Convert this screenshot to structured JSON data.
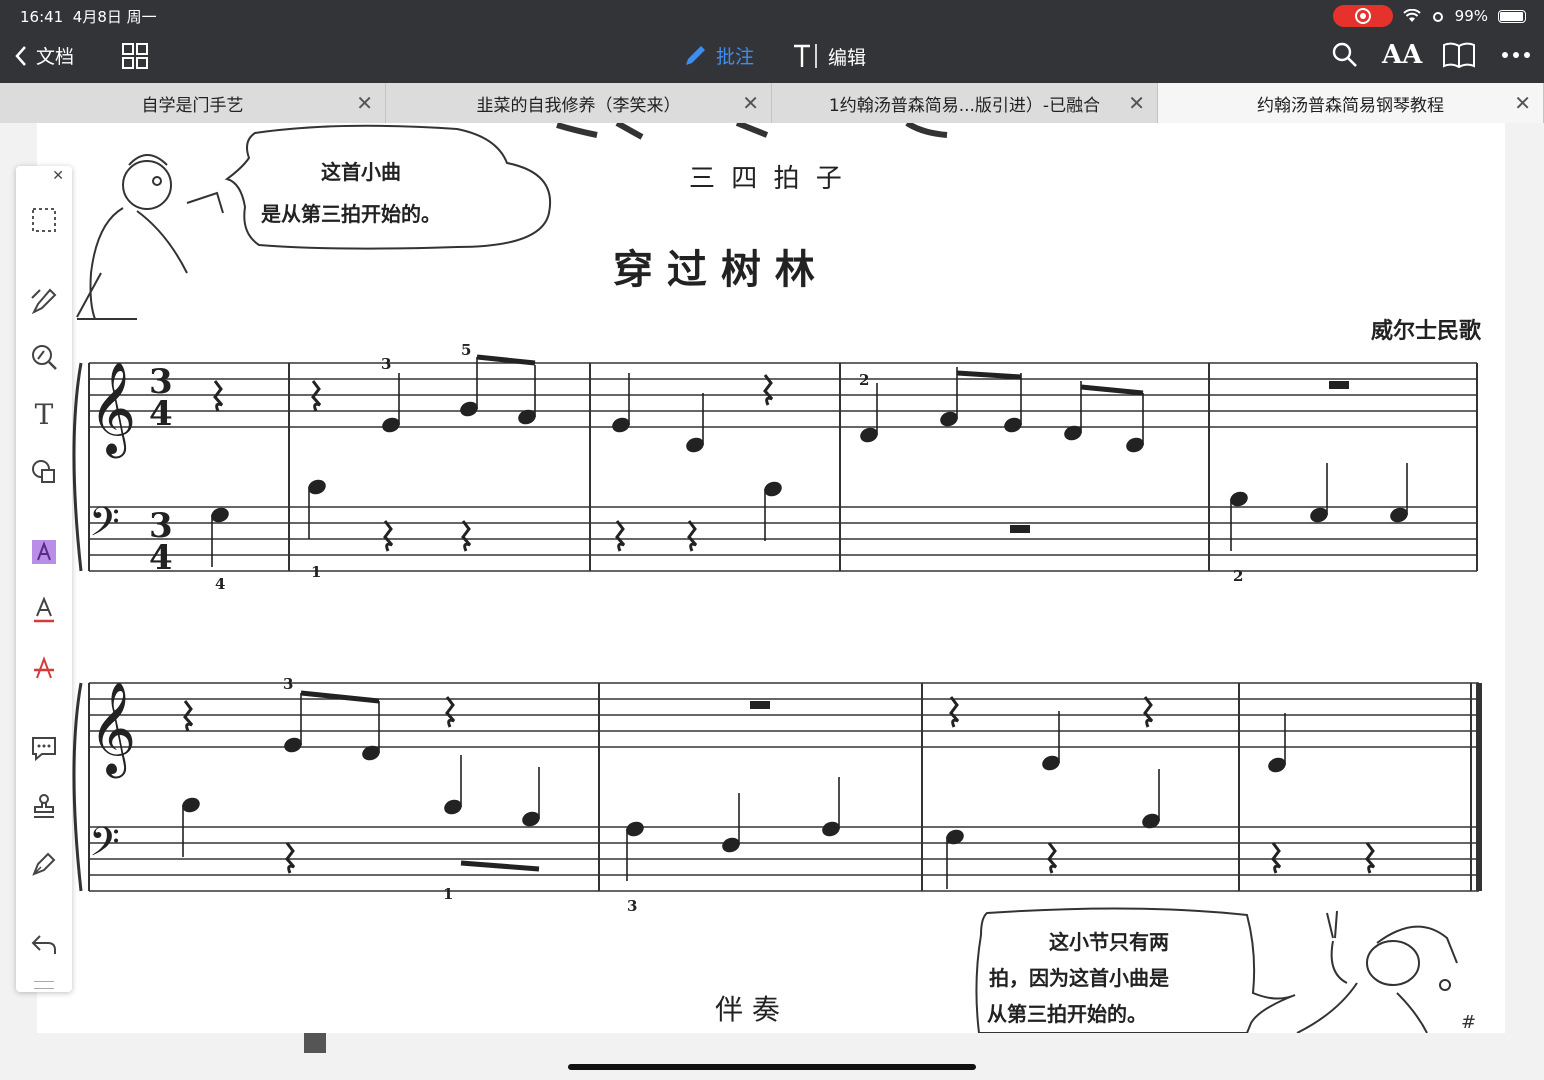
{
  "status_bar": {
    "time": "16:41",
    "date": "4月8日 周一",
    "battery": "99%"
  },
  "toolbar": {
    "back_label": "文档",
    "annotate_label": "批注",
    "edit_label": "编辑",
    "font_size_label": "AA"
  },
  "tabs": [
    {
      "label": "自学是门手艺"
    },
    {
      "label": "韭菜的自我修养（李笑来）"
    },
    {
      "label": "1约翰汤普森简易...版引进）-已融合"
    },
    {
      "label": "约翰汤普森简易钢琴教程"
    }
  ],
  "sheet": {
    "time_signature_label": "三 四 拍 子",
    "title": "穿 过 树 林",
    "composer": "威尔士民歌",
    "bubble_top_line1": "这首小曲",
    "bubble_top_line2": "是从第三拍开始的。",
    "bubble_bottom_line1": "这小节只有两",
    "bubble_bottom_line2": "拍，因为这首小曲是",
    "bubble_bottom_line3": "从第三拍开始的。",
    "accompaniment_label": "伴 奏",
    "time_sig_top": "3",
    "time_sig_bottom": "4",
    "fingerings": [
      "3",
      "5",
      "2",
      "4",
      "1",
      "2",
      "3",
      "1",
      "3"
    ]
  }
}
